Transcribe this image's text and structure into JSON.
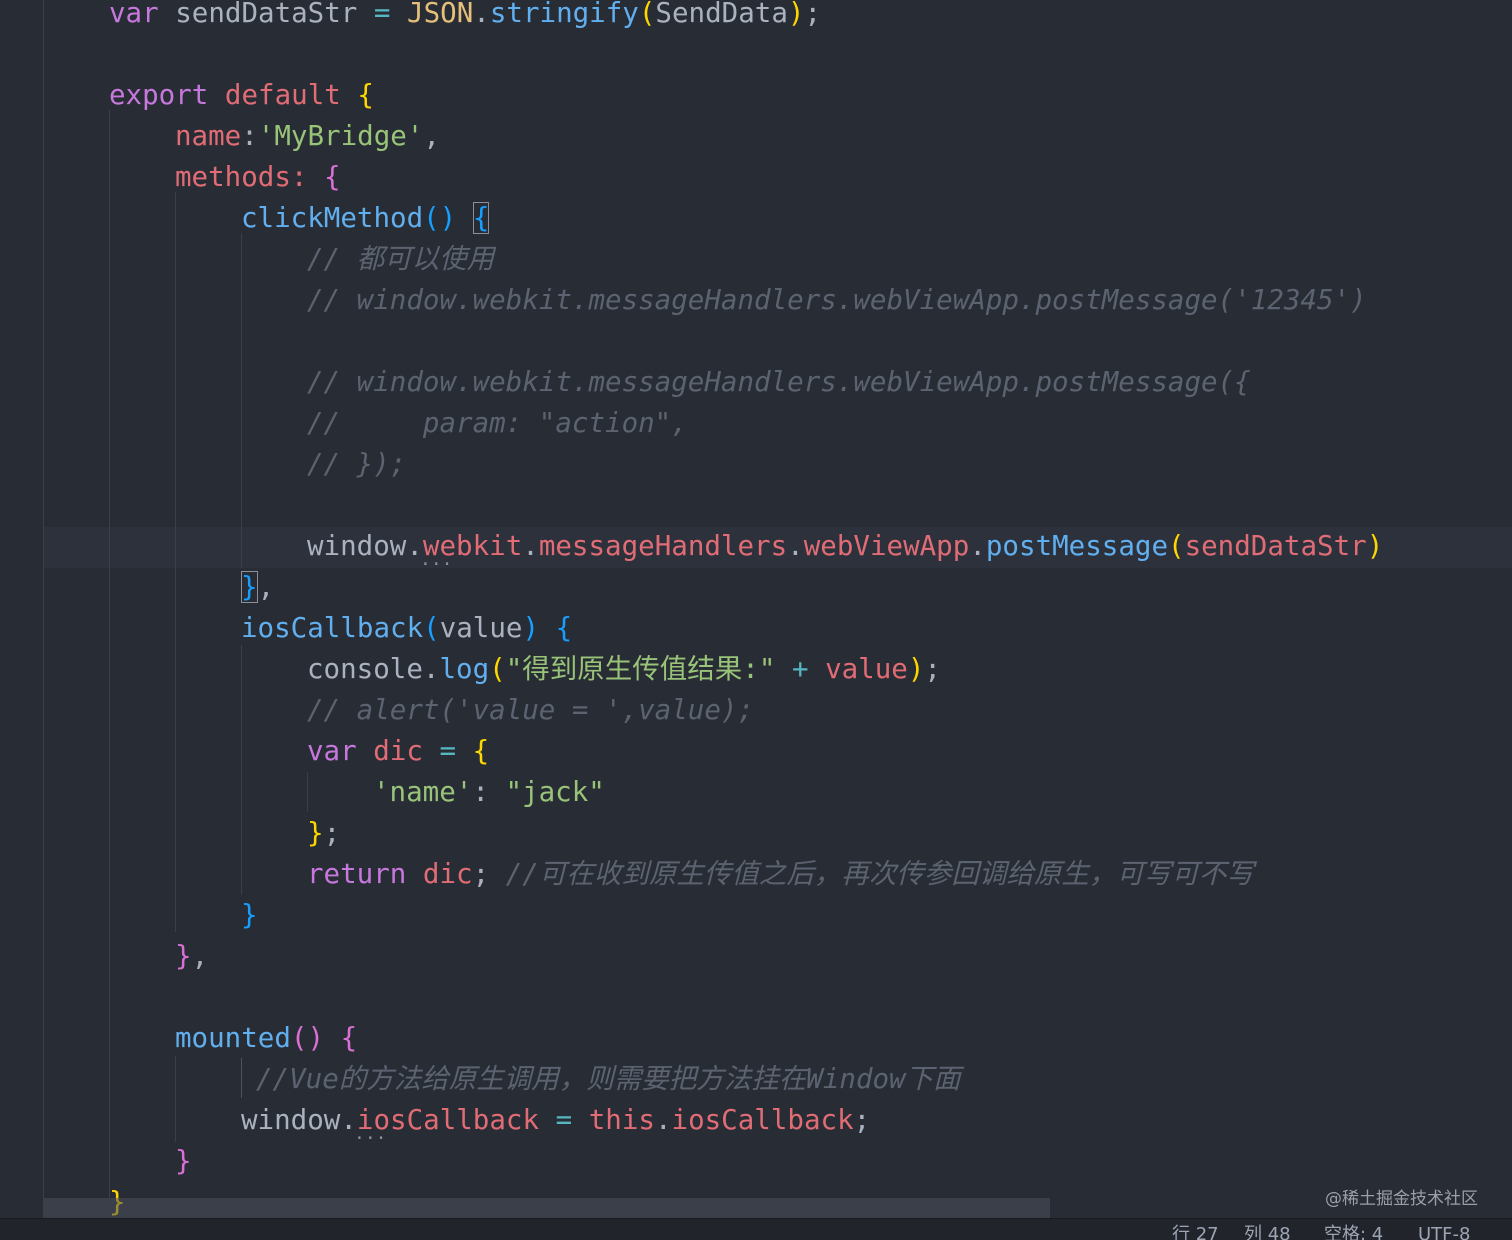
{
  "code": {
    "l1": [
      "var",
      "sendDataStr",
      "=",
      "JSON",
      ".",
      "stringify",
      "(",
      "SendData",
      ")",
      ";"
    ],
    "l3": [
      "export",
      "default",
      "{"
    ],
    "l4": [
      "name",
      ":",
      "'MyBridge'",
      ","
    ],
    "l5": [
      "methods",
      ":",
      "{"
    ],
    "l6": [
      "clickMethod",
      "()",
      "{"
    ],
    "l7": "// 都可以使用",
    "l8": "// window.webkit.messageHandlers.webViewApp.postMessage('12345')",
    "l10": "// window.webkit.messageHandlers.webViewApp.postMessage({",
    "l11": "//     param: \"action\",",
    "l12": "// });",
    "l14": [
      "window",
      ".",
      "webkit",
      ".",
      "messageHandlers",
      ".",
      "webViewApp",
      ".",
      "postMessage",
      "(",
      "sendDataStr",
      ")"
    ],
    "l15": [
      "}",
      ","
    ],
    "l16": [
      "iosCallback",
      "(",
      "value",
      ")",
      "{"
    ],
    "l17": [
      "console",
      ".",
      "log",
      "(",
      "\"得到原生传值结果:\"",
      "+",
      "value",
      ")",
      ";"
    ],
    "l18": "// alert('value = ',value);",
    "l19": [
      "var",
      "dic",
      "=",
      "{"
    ],
    "l20": [
      "'name'",
      ":",
      "\"jack\""
    ],
    "l21": [
      "}",
      ";"
    ],
    "l22": [
      "return",
      "dic",
      ";",
      "//可在收到原生传值之后，再次传参回调给原生，可写可不写"
    ],
    "l23": "}",
    "l24": [
      "}",
      ","
    ],
    "l26": [
      "mounted",
      "()",
      "{"
    ],
    "l27": "//Vue的方法给原生调用，则需要把方法挂在Window下面",
    "l28": [
      "window",
      ".",
      "iosCallback",
      "=",
      "this",
      ".",
      "iosCallback",
      ";"
    ],
    "l29": "}",
    "l30": "}"
  },
  "watermark": "@稀土掘金技术社区",
  "status": {
    "line": "行 27",
    "col": "列 48",
    "spaces": "空格: 4",
    "encoding": "UTF-8"
  },
  "colors": {
    "background": "#282c34",
    "keyword": "#c678dd",
    "property": "#e06c75",
    "function": "#61afef",
    "string": "#98c379",
    "class": "#e5c07b",
    "comment": "#5c6370"
  }
}
